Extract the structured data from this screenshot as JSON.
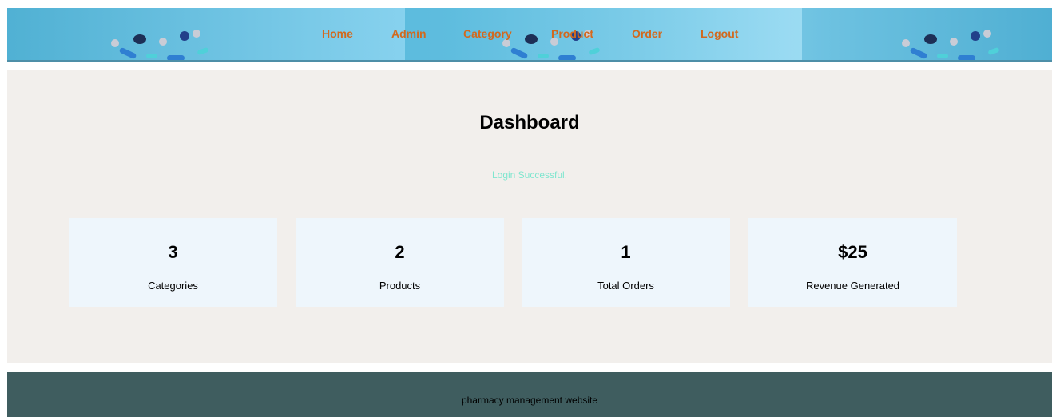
{
  "nav": {
    "items": [
      {
        "label": "Home"
      },
      {
        "label": "Admin"
      },
      {
        "label": "Category"
      },
      {
        "label": "Product"
      },
      {
        "label": "Order"
      },
      {
        "label": "Logout"
      }
    ],
    "link_color": "#d2691e"
  },
  "main": {
    "title": "Dashboard",
    "status_message": "Login Successful.",
    "status_color": "#7fe6cf",
    "stats": [
      {
        "value": "3",
        "label": "Categories"
      },
      {
        "value": "2",
        "label": "Products"
      },
      {
        "value": "1",
        "label": "Total Orders"
      },
      {
        "value": "$25",
        "label": "Revenue Generated"
      }
    ]
  },
  "footer": {
    "text": "pharmacy management website"
  },
  "colors": {
    "header_blue": "#79cbe8",
    "content_bg": "#f2efec",
    "card_bg": "#eef6fc",
    "footer_bg": "#3f5d5f"
  }
}
